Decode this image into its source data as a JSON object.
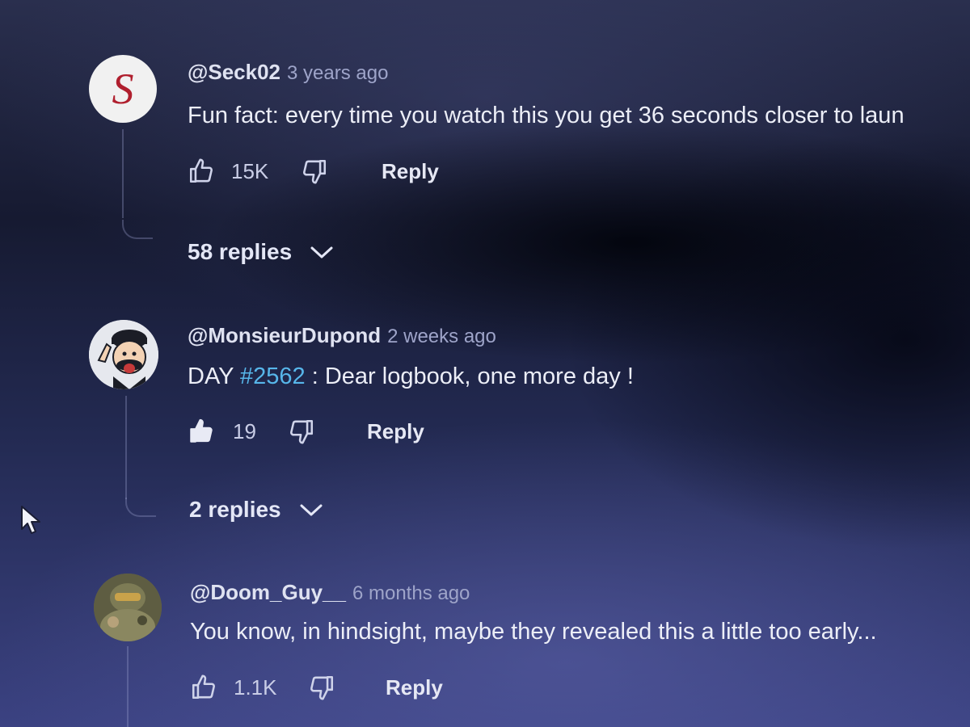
{
  "comments": [
    {
      "author": "@Seck02",
      "time": "3 years ago",
      "text": "Fun fact: every time you watch this you get 36 seconds closer to laun",
      "likes": "15K",
      "reply_label": "Reply",
      "replies_label": "58 replies",
      "avatar_letter": "S"
    },
    {
      "author": "@MonsieurDupond",
      "time": "2 weeks ago",
      "text_before": "DAY ",
      "hashtag": "#2562",
      "text_after": " : Dear logbook, one more day !",
      "likes": "19",
      "reply_label": "Reply",
      "replies_label": "2 replies"
    },
    {
      "author": "@Doom_Guy__",
      "time": "6 months ago",
      "text": "You know, in hindsight, maybe they revealed this a little too early...",
      "likes": "1.1K",
      "reply_label": "Reply"
    }
  ],
  "icons": {
    "like": "thumbs-up-icon",
    "like_filled": "thumbs-up-filled-icon",
    "dislike": "thumbs-down-icon",
    "expand": "chevron-down-icon",
    "pointer": "mouse-cursor-icon"
  },
  "colors": {
    "hashtag": "#57b6ea",
    "s_logo": "#b01f2e"
  }
}
